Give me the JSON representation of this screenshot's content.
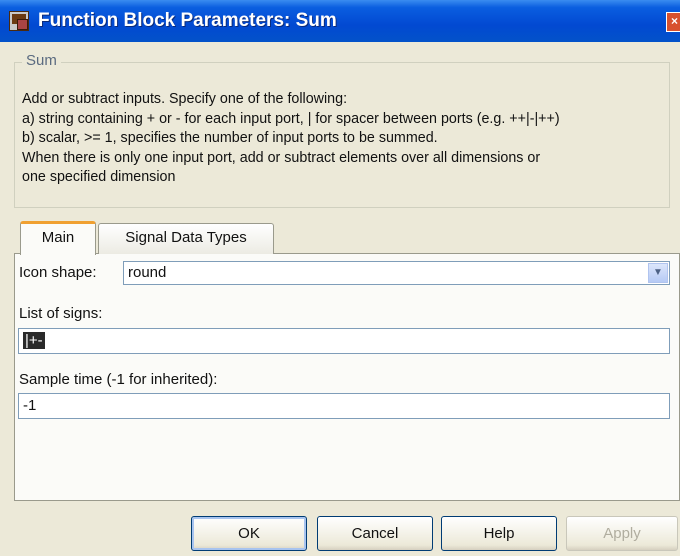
{
  "window": {
    "title": "Function Block Parameters: Sum",
    "close_glyph": "×"
  },
  "block_group": {
    "legend": "Sum",
    "description_lines": [
      "Add or subtract inputs.  Specify one of the following:",
      "a) string containing + or - for each input port, | for spacer between ports (e.g. ++|-|++)",
      "b) scalar, >= 1, specifies the number of input ports to be summed.",
      "When there is only one input port, add or subtract elements over all dimensions or",
      "one specified dimension"
    ]
  },
  "tabs": [
    {
      "label": "Main",
      "active": true
    },
    {
      "label": "Signal Data Types",
      "active": false
    }
  ],
  "params": {
    "icon_shape": {
      "label": "Icon shape:",
      "value": "round",
      "arrow_icon": "chevron-down-icon"
    },
    "list_of_signs": {
      "label": "List of signs:",
      "value": "|+-"
    },
    "sample_time": {
      "label": "Sample time (-1 for inherited):",
      "value": "-1"
    }
  },
  "buttons": {
    "ok": "OK",
    "cancel": "Cancel",
    "help": "Help",
    "apply": "Apply"
  },
  "colors": {
    "titlebar": "#0249d2",
    "dialog_bg": "#ece9d8",
    "active_tab_accent": "#f0a030"
  }
}
